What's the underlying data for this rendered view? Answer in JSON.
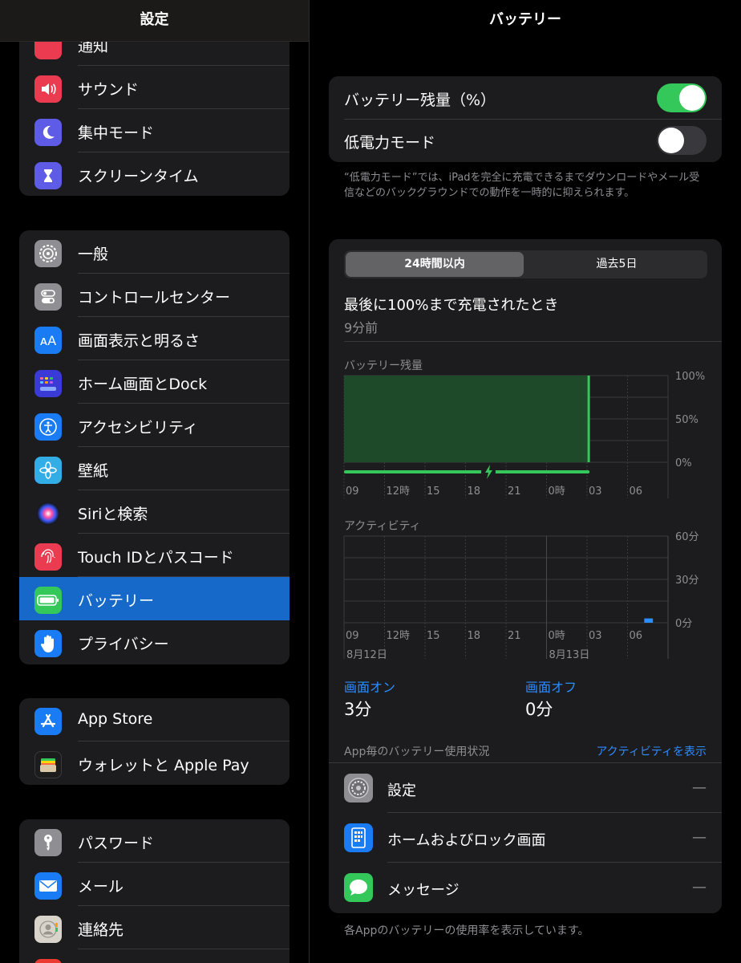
{
  "sidebar": {
    "title": "設定",
    "partial_item": "通知",
    "group1": [
      {
        "label": "サウンド",
        "icon": "speaker-icon",
        "color": "#eb3b50"
      },
      {
        "label": "集中モード",
        "icon": "moon-icon",
        "color": "#5e5ce6"
      },
      {
        "label": "スクリーンタイム",
        "icon": "hourglass-icon",
        "color": "#5e5ce6"
      }
    ],
    "group2": [
      {
        "label": "一般",
        "icon": "gear-icon",
        "color": "#8e8e93"
      },
      {
        "label": "コントロールセンター",
        "icon": "toggles-icon",
        "color": "#8e8e93"
      },
      {
        "label": "画面表示と明るさ",
        "icon": "text-size-icon",
        "color": "#1a7cf5"
      },
      {
        "label": "ホーム画面とDock",
        "icon": "app-grid-icon",
        "color": "#3a3ad6"
      },
      {
        "label": "アクセシビリティ",
        "icon": "accessibility-icon",
        "color": "#1a7cf5"
      },
      {
        "label": "壁紙",
        "icon": "flower-icon",
        "color": "#32ade6"
      },
      {
        "label": "Siriと検索",
        "icon": "siri-icon",
        "color": "#2a2a2a"
      },
      {
        "label": "Touch IDとパスコード",
        "icon": "fingerprint-icon",
        "color": "#eb3b50"
      },
      {
        "label": "バッテリー",
        "icon": "battery-icon",
        "color": "#34c759"
      },
      {
        "label": "プライバシー",
        "icon": "hand-icon",
        "color": "#1a7cf5"
      }
    ],
    "group3": [
      {
        "label": "App Store",
        "icon": "app-store-icon",
        "color": "#1a7cf5"
      },
      {
        "label": "ウォレットと Apple Pay",
        "icon": "wallet-icon",
        "color": "#1c1c1c"
      }
    ],
    "group4": [
      {
        "label": "パスワード",
        "icon": "key-icon",
        "color": "#8e8e93"
      },
      {
        "label": "メール",
        "icon": "mail-icon",
        "color": "#1a7cf5"
      },
      {
        "label": "連絡先",
        "icon": "contacts-icon",
        "color": "#bdbdbd"
      }
    ]
  },
  "battery": {
    "title": "バッテリー",
    "percentage_label": "バッテリー残量（%）",
    "percentage_on": true,
    "low_power_label": "低電力モード",
    "low_power_on": false,
    "footnote": "“低電力モード”では、iPadを完全に充電できるまでダウンロードやメール受信などのバックグラウンドでの動作を一時的に抑えられます。",
    "segments": [
      "24時間以内",
      "過去5日"
    ],
    "last_charged_title": "最後に100%まで充電されたとき",
    "last_charged_time": "9分前",
    "level_chart_label": "バッテリー残量",
    "activity_chart_label": "アクティビティ",
    "screen_on_label": "画面オン",
    "screen_on_value": "3分",
    "screen_off_label": "画面オフ",
    "screen_off_value": "0分",
    "usage_header": "App毎のバッテリー使用状況",
    "show_activity_link": "アクティビティを表示",
    "apps": [
      {
        "name": "設定",
        "icon": "settings-gear-icon",
        "value": "—"
      },
      {
        "name": "ホームおよびロック画面",
        "icon": "ipad-icon",
        "value": "—"
      },
      {
        "name": "メッセージ",
        "icon": "messages-icon",
        "value": "—"
      }
    ],
    "bottom_note": "各Appのバッテリーの使用率を表示しています。"
  },
  "chart_data": [
    {
      "type": "area",
      "title": "バッテリー残量",
      "x": [
        "09",
        "12時",
        "15",
        "18",
        "21",
        "0時",
        "03",
        "06"
      ],
      "y_ticks": [
        "100%",
        "50%",
        "0%"
      ],
      "ylim": [
        0,
        100
      ],
      "series": [
        {
          "values": [
            100,
            100,
            100,
            100,
            100,
            100,
            100,
            100
          ]
        }
      ],
      "charging": "entire period",
      "colors": {
        "fill": "#1f4a2a",
        "line": "#34c759"
      }
    },
    {
      "type": "bar",
      "title": "アクティビティ",
      "x": [
        "09",
        "12時",
        "15",
        "18",
        "21",
        "0時",
        "03",
        "06"
      ],
      "date_labels": [
        "8月12日",
        "8月13日"
      ],
      "y_ticks": [
        "60分",
        "30分",
        "0分"
      ],
      "ylim": [
        0,
        60
      ],
      "values": [
        0,
        0,
        0,
        0,
        0,
        0,
        0,
        0,
        0,
        0,
        0,
        0,
        0,
        0,
        0,
        0,
        0,
        0,
        0,
        0,
        0,
        0,
        0,
        3
      ],
      "colors": {
        "bar": "#2d8cff"
      }
    }
  ]
}
